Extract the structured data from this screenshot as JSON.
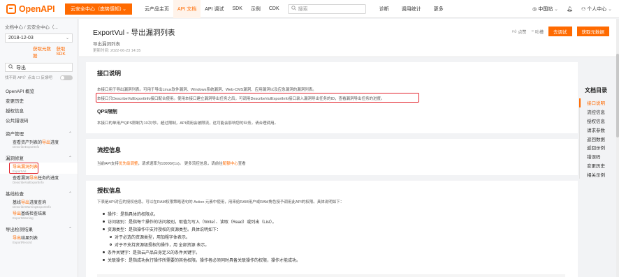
{
  "topbar": {
    "logo_text": "OpenAPI",
    "promo_label": "云安全中心（态势感知）",
    "promo_chevron": "⌄",
    "nav": [
      "云产品主页",
      "API 文档",
      "API 调试",
      "SDK",
      "示例",
      "CDK"
    ],
    "search_placeholder": "搜索",
    "nav2": [
      "诊断",
      "调用统计",
      "更多"
    ],
    "site": "中国站",
    "account": "个人中心"
  },
  "sidebar": {
    "breadcrumb": "文档中心 / 云安全中心（...",
    "version": "2018-12-03",
    "link_metadata": "获取元数据",
    "link_sdk": "获取 SDK",
    "search_value": "导出",
    "toggle_text": "找不到 API？点击 ☐ 反馈吧",
    "items": [
      {
        "label": "OpenAPI 概览"
      },
      {
        "label": "变更历史"
      },
      {
        "label": "授权信息"
      },
      {
        "label": "公共错误码"
      }
    ],
    "groups": [
      {
        "label": "资产管理",
        "subs": [
          {
            "pre": "查看资产列表的",
            "hl": "导出",
            "post": "进度",
            "api": "DescribeExportInfo",
            "active": false
          }
        ]
      },
      {
        "label": "漏洞修复",
        "subs": [
          {
            "pre": "",
            "hl": "导出",
            "post": "漏洞列表",
            "api": "ExportVul",
            "active": true
          },
          {
            "pre": "查看漏洞",
            "hl": "导出",
            "post": "任务的进度",
            "api": "DescribeVulExportInfo",
            "active": false
          }
        ]
      },
      {
        "label": "基线检查",
        "subs": [
          {
            "pre": "基线",
            "hl": "导出",
            "post": "进度查询",
            "api": "DescribeWarningExportInfo",
            "active": false
          },
          {
            "pre": "",
            "hl": "导出",
            "post": "基线检查结果",
            "api": "ExportWarning",
            "active": false
          }
        ]
      },
      {
        "label": "导出检测结果",
        "subs": [
          {
            "pre": "",
            "hl": "导出",
            "post": "结果列表",
            "api": "ExportRecord",
            "active": false
          }
        ]
      }
    ]
  },
  "header": {
    "title": "ExportVul - 导出漏洞列表",
    "subtitle": "导出漏洞列表",
    "updated": "更新时间: 2022-06-23 14:35",
    "like": "点赞",
    "dislike": "吐槽",
    "debug": "去调试",
    "metadata": "获取元数据"
  },
  "sections": {
    "desc": {
      "title": "接口说明",
      "line1": "本接口用于导出漏洞列表。可用于导出Linux软件漏洞、Windows系统漏洞、Web-CMS漏洞、应用漏洞以及应急漏洞的漏洞列表。",
      "line2": "本接口只DescribeVulExportInfo接口配合使用。使用本接口建立漏洞导出任务之后，可调用DescribeVulExportInfo接口录入漏洞导出任务的ID，查看漏洞导出任务的进度。",
      "qps_title": "QPS限制",
      "qps_text": "本接口的单用户QPS限制为10次/秒。超过限制，API调用会被限流，这可能会影响您的业务，请合理调用。"
    },
    "flow": {
      "title": "流控信息",
      "pre": "当前API支持",
      "hl1": "优先级调整",
      "mid": "，请求速率为10000/(1s)。  更多流控信息，请前往",
      "hl2": "配额中心",
      "post": "查看"
    },
    "auth": {
      "title": "授权信息",
      "intro": "下表是API对应的授权信息，可以在RAM权限策略语句的  Action  元素中使用，用来给RAM用户或RAM角色授予调用此API的权限。具体说明如下：",
      "bullets": [
        {
          "text": "操作：是指具体的权限点。",
          "indent": false
        },
        {
          "text": "访问级别：是指每个操作的访问级别，取值为写入（Write）、读取（Read）或列出（List）。",
          "indent": false
        },
        {
          "text": "资源类型：是指操作中支持授权的资源类型。具体说明如下：",
          "indent": false
        },
        {
          "text": "对于必选的资源类型，用加粗字体表示。",
          "indent": true
        },
        {
          "text": "对于不支持资源级授权的操作，用  全部资源  表示。",
          "indent": true
        },
        {
          "text": "条件关键字：是指云产品自身定义的条件关键字。",
          "indent": false
        },
        {
          "text": "关联操作：是指成功执行操作所需要的其他权限。操作者必须同时具备关联操作的权限，操作才能成功。",
          "indent": false
        }
      ]
    }
  },
  "toc": {
    "title": "文档目录",
    "items": [
      "接口说明",
      "流控信息",
      "授权信息",
      "请求参数",
      "返回数据",
      "返回示例",
      "错误码",
      "变更历史",
      "相关示例"
    ]
  },
  "colors": {
    "accent": "#ff6a00",
    "highlight_box": "#e3232c"
  }
}
